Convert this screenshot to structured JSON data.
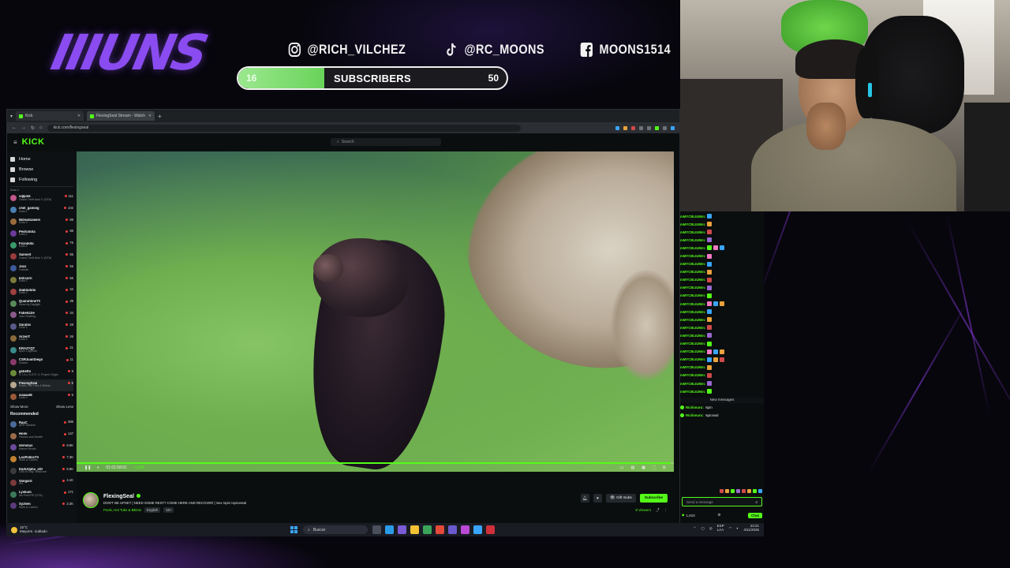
{
  "overlay": {
    "logo_text": "IIIUNS",
    "socials": [
      {
        "icon": "instagram-icon",
        "handle": "@RICH_VILCHEZ"
      },
      {
        "icon": "tiktok-icon",
        "handle": "@RC_MOONS"
      },
      {
        "icon": "facebook-icon",
        "handle": "MOONS1514"
      }
    ],
    "subscribers": {
      "current": "16",
      "label": "SUBSCRIBERS",
      "goal": "50",
      "progress_fraction": 0.32
    },
    "accent_color": "#8a4cf0"
  },
  "browser": {
    "tabs": [
      {
        "label": "Kick",
        "active": false
      },
      {
        "label": "FlexingSeal Stream - Watch",
        "active": true
      }
    ],
    "url": "kick.com/flexingseal"
  },
  "kick": {
    "logo": "KICK",
    "search_placeholder": "Search",
    "brand_color": "#53fc18",
    "nav": [
      {
        "icon": "home-icon",
        "label": "Home"
      },
      {
        "icon": "browse-icon",
        "label": "Browse"
      },
      {
        "icon": "following-icon",
        "label": "Following"
      }
    ],
    "following_label_top": "Dota 2",
    "following": [
      {
        "name": "xqlpink",
        "game": "Grand Theft Auto V (GTA)",
        "viewers": "111",
        "color": "#c2578b"
      },
      {
        "name": "chill_gaming",
        "game": "Dota 2",
        "viewers": "102",
        "color": "#4a7fb5"
      },
      {
        "name": "NdreaGamers",
        "game": "Dota 2",
        "viewers": "89",
        "color": "#9a6b3b"
      },
      {
        "name": "Pedrodota",
        "game": "Dota 2",
        "viewers": "88",
        "color": "#6b3b9a"
      },
      {
        "name": "Fozodota",
        "game": "Dota 2",
        "viewers": "75",
        "color": "#3b9a6b"
      },
      {
        "name": "Sanneit",
        "game": "Grand Theft Auto V (GTA)",
        "viewers": "65",
        "color": "#9a3b3b"
      },
      {
        "name": "Jaxx",
        "game": "Fortnite",
        "viewers": "55",
        "color": "#3b5b9a"
      },
      {
        "name": "bolicorn",
        "game": "Dota 2",
        "viewers": "55",
        "color": "#7a7a3b"
      },
      {
        "name": "diablodota",
        "game": "Dota 2",
        "viewers": "42",
        "color": "#a04040"
      },
      {
        "name": "QuarantineTV",
        "game": "Dead by Daylight",
        "viewers": "39",
        "color": "#5a8a5a"
      },
      {
        "name": "Fabelizzle",
        "game": "Just Chatting",
        "viewers": "34",
        "color": "#8a5a8a"
      },
      {
        "name": "Saratov",
        "game": "Dota 2",
        "viewers": "29",
        "color": "#5a5a8a"
      },
      {
        "name": "ArzenT",
        "game": "Dota 2",
        "viewers": "26",
        "color": "#8a6a3a"
      },
      {
        "name": "KRAZYQT",
        "game": "Apex Legends",
        "viewers": "21",
        "color": "#3a8a8a"
      },
      {
        "name": "CSRJuanDiego",
        "game": "Roblox",
        "viewers": "11",
        "color": "#8a3a6a"
      },
      {
        "name": "gebetto",
        "game": "S.T.A.L.K.E.R. 2: Project Origin",
        "viewers": "9",
        "color": "#6a8a3a"
      },
      {
        "name": "FlexingSeal",
        "game": "Pools, Hot Tubs & Bikinis",
        "viewers": "6",
        "color": "#b8a890",
        "active": true
      },
      {
        "name": "xiaaaalili",
        "game": "Dota 2",
        "viewers": "5",
        "color": "#9a5a3a"
      }
    ],
    "show_more": "Show More",
    "show_less": "Show Less",
    "recommended_heading": "Recommended",
    "recommended": [
      {
        "name": "RayC",
        "game": "ARC Raiders",
        "viewers": "386",
        "color": "#4a6a9a"
      },
      {
        "name": "Homi",
        "game": "Fitness and Health",
        "viewers": "147",
        "color": "#9a6a4a"
      },
      {
        "name": "dominux",
        "game": "Marvel Rivals",
        "viewers": "8.9K",
        "color": "#6a4a9a"
      },
      {
        "name": "LosPollosTV",
        "game": "Slots & Casino",
        "viewers": "7.3K",
        "color": "#c08030"
      },
      {
        "name": "DarkAlpha_xDI",
        "game": "Call of Duty: Warzone",
        "viewers": "6.9K",
        "color": "#3a3a3a"
      },
      {
        "name": "Vangard",
        "game": "IRL",
        "viewers": "4.1K",
        "color": "#7a3a3a"
      },
      {
        "name": "Lyskum",
        "game": "No Pixel RP (GTA)",
        "viewers": "171",
        "color": "#3a7a5a"
      },
      {
        "name": "Syztem",
        "game": "Slots & Casino",
        "viewers": "3.3K",
        "color": "#5a3a7a"
      }
    ]
  },
  "player": {
    "time": "01:01:58:01",
    "live": "• LIVE",
    "progress_fraction": 0.995
  },
  "stream": {
    "streamer": "FlexingSeal",
    "title": "DON'T BE UPSET | NEED SOME REST? COME HERE AND RECOVER | !sex !spin !spicoseal",
    "category": "Pools, Hot Tubs & Bikinis",
    "tags": [
      "English",
      "18+"
    ],
    "gift_label": "Gift Subs",
    "subscribe_label": "Subscribe",
    "viewers": "8 Viewers"
  },
  "chat": {
    "spam_user": "mMYCBLIUMm:",
    "spam_lines": 23,
    "new_messages": "New messages",
    "messages": [
      {
        "user": "Richimuru:",
        "text": "!spin"
      },
      {
        "user": "Richimuru:",
        "text": "!spicseal"
      }
    ],
    "input_placeholder": "Send a message",
    "points": "1,810",
    "send_label": "Chat"
  },
  "taskbar": {
    "weather_temp": "15°C",
    "weather_desc": "Mayorm. nublado",
    "search": "Buscar",
    "lang": "ESP",
    "lang2": "LAA",
    "time": "23:21",
    "date": "4/11/2025"
  }
}
